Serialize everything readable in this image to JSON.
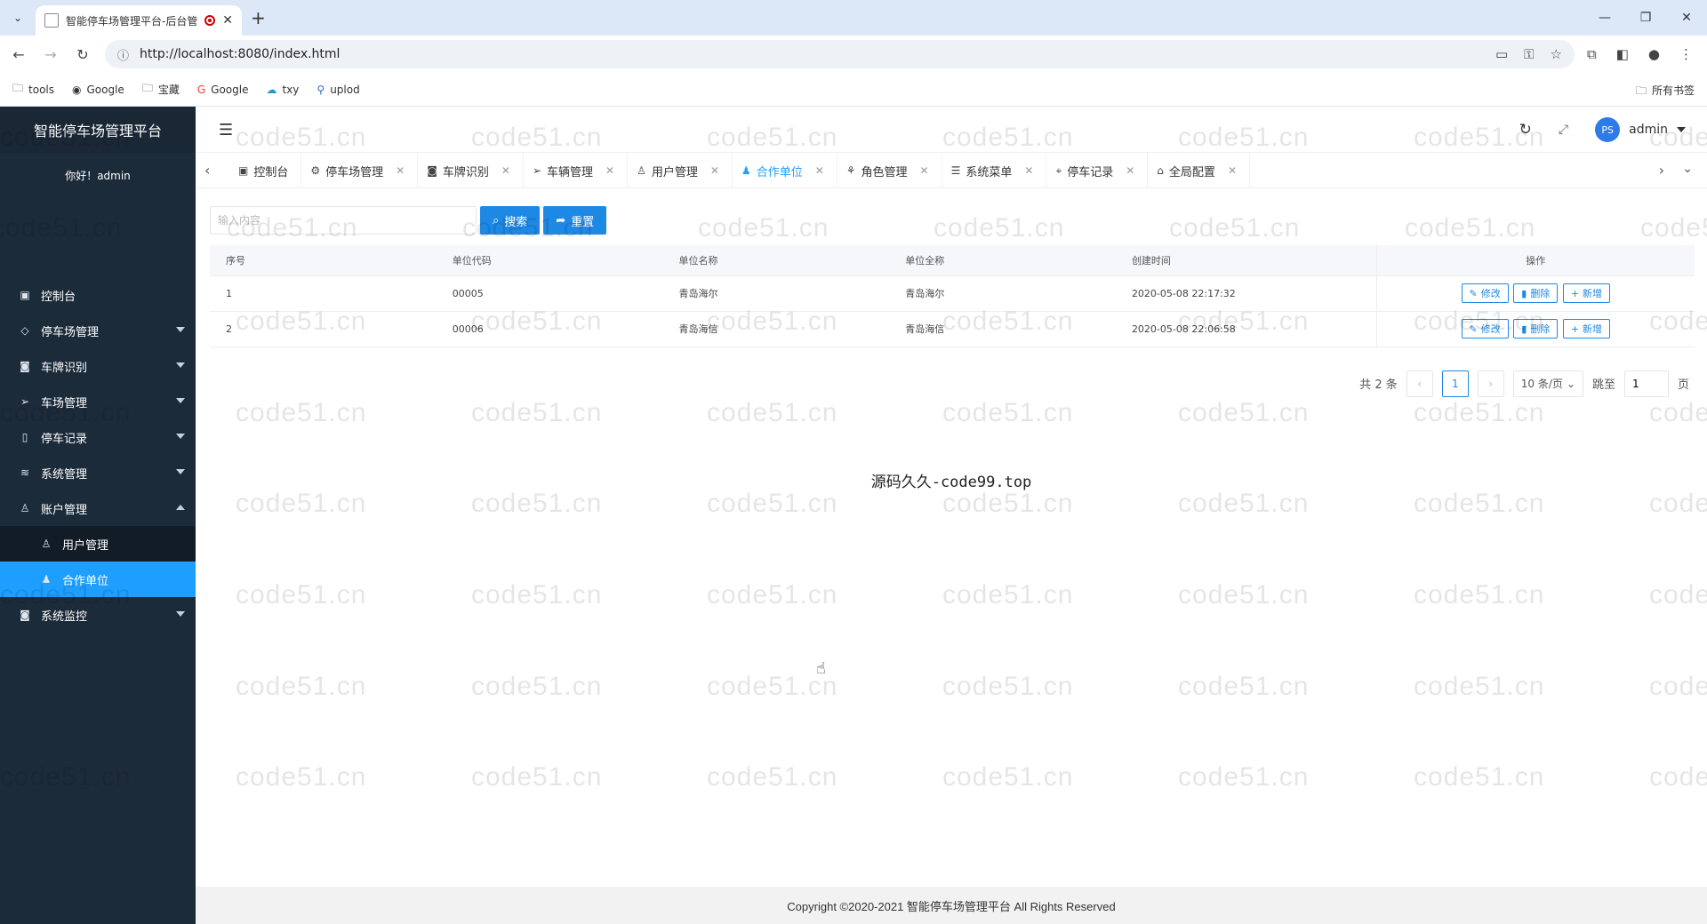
{
  "browser": {
    "tab_title": "智能停车场管理平台-后台管",
    "url": "http://localhost:8080/index.html",
    "bookmarks": [
      {
        "label": "tools",
        "icon": "folder-icon"
      },
      {
        "label": "Google",
        "icon": "globe-icon"
      },
      {
        "label": "宝藏",
        "icon": "folder-icon"
      },
      {
        "label": "Google",
        "icon": "google-icon"
      },
      {
        "label": "txy",
        "icon": "cloud-icon"
      },
      {
        "label": "uplod",
        "icon": "link-icon"
      }
    ],
    "all_bookmarks": "所有书签"
  },
  "sidebar": {
    "logo": "智能停车场管理平台",
    "greeting": "你好！admin",
    "items": [
      {
        "label": "控制台",
        "icon": "monitor-icon"
      },
      {
        "label": "停车场管理",
        "icon": "diamond-icon"
      },
      {
        "label": "车牌识别",
        "icon": "camera-icon"
      },
      {
        "label": "车场管理",
        "icon": "send-icon"
      },
      {
        "label": "停车记录",
        "icon": "note-icon"
      },
      {
        "label": "系统管理",
        "icon": "layers-icon"
      },
      {
        "label": "账户管理",
        "icon": "user-icon"
      }
    ],
    "sub_items": [
      {
        "label": "用户管理",
        "icon": "user-icon"
      },
      {
        "label": "合作单位",
        "icon": "user-solid-icon"
      }
    ],
    "last_item": {
      "label": "系统监控",
      "icon": "camera-icon"
    }
  },
  "header": {
    "user": "admin",
    "avatar": "PS"
  },
  "tabs": [
    {
      "label": "控制台",
      "icon": "monitor-icon",
      "closable": false
    },
    {
      "label": "停车场管理",
      "icon": "gear-icon",
      "closable": true
    },
    {
      "label": "车牌识别",
      "icon": "camera-icon",
      "closable": true
    },
    {
      "label": "车辆管理",
      "icon": "send-icon",
      "closable": true
    },
    {
      "label": "用户管理",
      "icon": "user-icon",
      "closable": true
    },
    {
      "label": "合作单位",
      "icon": "user-solid-icon",
      "closable": true,
      "active": true
    },
    {
      "label": "角色管理",
      "icon": "tree-icon",
      "closable": true
    },
    {
      "label": "系统菜单",
      "icon": "list-icon",
      "closable": true
    },
    {
      "label": "停车记录",
      "icon": "pin-icon",
      "closable": true
    },
    {
      "label": "全局配置",
      "icon": "config-icon",
      "closable": true
    }
  ],
  "search": {
    "placeholder": "输入内容",
    "search_btn": "搜索",
    "reset_btn": "重置"
  },
  "table": {
    "columns": [
      "序号",
      "单位代码",
      "单位名称",
      "单位全称",
      "创建时间",
      "操作"
    ],
    "rows": [
      [
        "1",
        "00005",
        "青岛海尔",
        "青岛海尔",
        "2020-05-08 22:17:32"
      ],
      [
        "2",
        "00006",
        "青岛海信",
        "青岛海信",
        "2020-05-08 22:06:58"
      ]
    ],
    "actions": [
      "修改",
      "删除",
      "新增"
    ]
  },
  "pager": {
    "total": "共 2 条",
    "current": "1",
    "page_size": "10 条/页",
    "jump_label": "跳至",
    "jump_value": "1",
    "page_unit": "页"
  },
  "note": "源码久久-code99.top",
  "footer": "Copyright ©2020-2021 智能停车场管理平台 All Rights Reserved",
  "watermark": "code51.cn",
  "colors": {
    "accent": "#1e9fff",
    "button": "#1e88e5",
    "sidebar": "#1c2b3a"
  }
}
